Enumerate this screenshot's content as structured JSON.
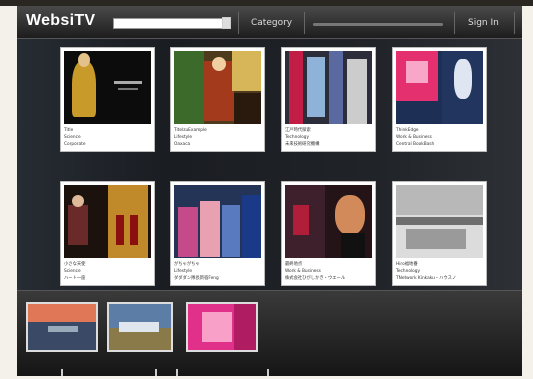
{
  "app": {
    "logo": "WebsiTV"
  },
  "header": {
    "category_label": "Category",
    "signin_label": "Sign In",
    "search_value": ""
  },
  "videos": [
    {
      "title": "Title",
      "category": "Science",
      "author": "Corporate"
    },
    {
      "title": "TitelzuExample",
      "category": "Lifestyle",
      "author": "Oaxaca"
    },
    {
      "title": "江戸時代探索",
      "category": "Technology",
      "author": "未来技術研究機構"
    },
    {
      "title": "ThinkEdge",
      "category": "Work & Business",
      "author": "Central BookBash"
    },
    {
      "title": "小さな天使",
      "category": "Science",
      "author": "ハート一座"
    },
    {
      "title": "がちゃがちゃ",
      "category": "Lifestyle",
      "author": "ダダダン隊長新宿Feng"
    },
    {
      "title": "最終地点",
      "category": "Work & Business",
      "author": "株式会社ひがしかき・ウエール"
    },
    {
      "title": "Hiro福地番",
      "category": "Technology",
      "author": "TNetwork Kinkaku・ハウスノ"
    }
  ],
  "bottom_strip": {
    "count": 3
  }
}
